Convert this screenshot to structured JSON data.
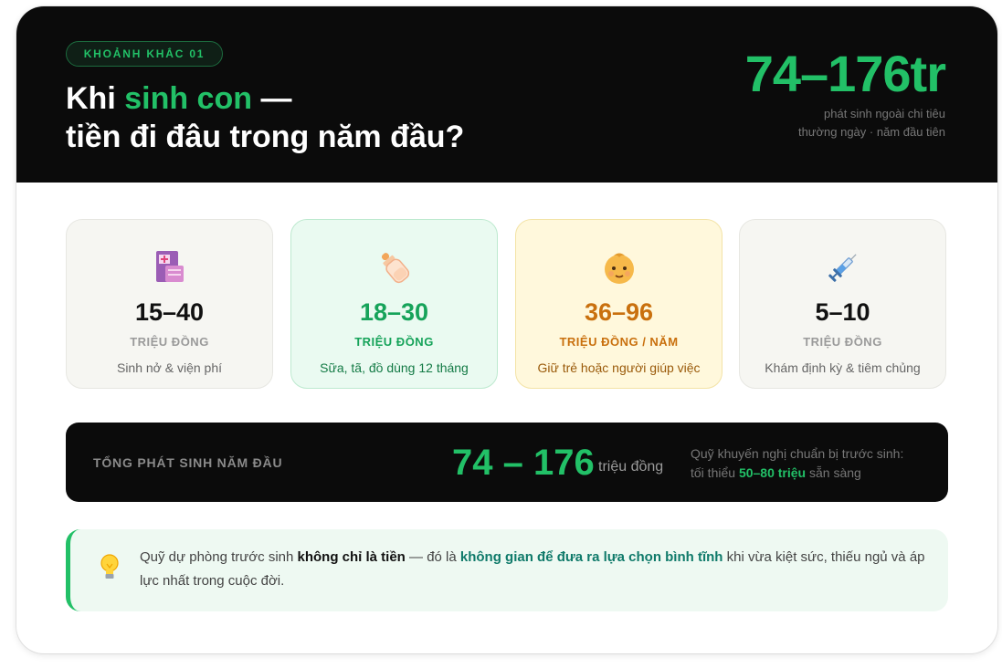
{
  "header": {
    "badge": "KHOẢNH KHẮC 01",
    "title_prefix": "Khi ",
    "title_accent": "sinh con",
    "title_dash": " —",
    "title_line2": "tiền đi đâu trong năm đầu?",
    "big_range": "74–176tr",
    "note_line1": "phát sinh ngoài chi tiêu",
    "note_line2": "thường ngày · năm đầu tiên"
  },
  "stats": [
    {
      "icon": "hospital-icon",
      "value": "15–40",
      "unit": "TRIỆU ĐỒNG",
      "desc": "Sinh nở & viện phí"
    },
    {
      "icon": "baby-bottle-icon",
      "value": "18–30",
      "unit": "TRIỆU ĐỒNG",
      "desc": "Sữa, tã, đồ dùng 12 tháng"
    },
    {
      "icon": "baby-face-icon",
      "value": "36–96",
      "unit": "TRIỆU ĐỒNG / NĂM",
      "desc": "Giữ trẻ hoặc người giúp việc"
    },
    {
      "icon": "syringe-icon",
      "value": "5–10",
      "unit": "TRIỆU ĐỒNG",
      "desc": "Khám định kỳ & tiêm chủng"
    }
  ],
  "total": {
    "label": "TỔNG PHÁT SINH NĂM ĐẦU",
    "value": "74 – 176",
    "unit": "triệu đồng",
    "rec_line1": "Quỹ khuyến nghị chuẩn bị trước sinh:",
    "rec_pre": "tối thiểu ",
    "rec_highlight": "50–80 triệu",
    "rec_post": " sẵn sàng"
  },
  "tip": {
    "icon": "light-bulb-icon",
    "t1": "Quỹ dự phòng trước sinh ",
    "b1": "không chỉ là tiền",
    "t2": " — đó là ",
    "b2": "không gian để đưa ra lựa chọn bình tĩnh",
    "t3": " khi vừa kiệt sức, thiếu ngủ và áp lực nhất trong cuộc đời."
  },
  "colors": {
    "accent": "#22c067",
    "dark": "#0b0b0b",
    "orange": "#c9700e"
  }
}
